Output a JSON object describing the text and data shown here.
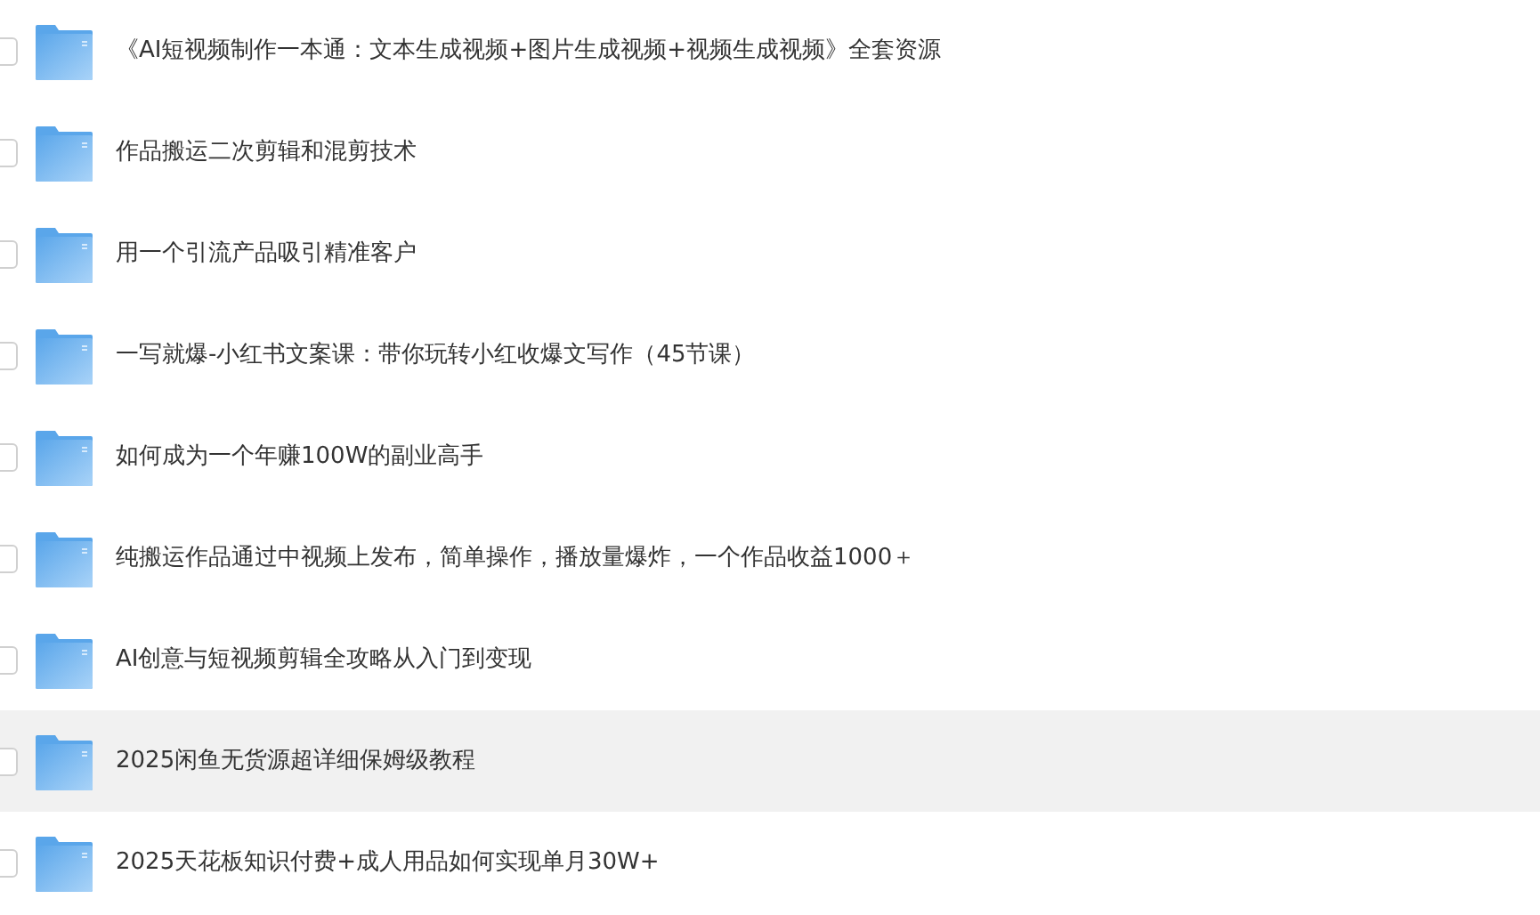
{
  "files": [
    {
      "name": "《AI短视频制作一本通：文本生成视频+图片生成视频+视频生成视频》全套资源",
      "checked": false,
      "highlighted": false
    },
    {
      "name": "作品搬运二次剪辑和混剪技术",
      "checked": false,
      "highlighted": false
    },
    {
      "name": "用一个引流产品吸引精准客户",
      "checked": false,
      "highlighted": false
    },
    {
      "name": "一写就爆-小红书文案课：带你玩转小红收爆文写作（45节课）",
      "checked": false,
      "highlighted": false
    },
    {
      "name": "如何成为一个年赚100W的副业高手",
      "checked": false,
      "highlighted": false
    },
    {
      "name": "纯搬运作品通过中视频上发布，简单操作，播放量爆炸，一个作品收益1000＋",
      "checked": false,
      "highlighted": false
    },
    {
      "name": "AI创意与短视频剪辑全攻略从入门到变现",
      "checked": false,
      "highlighted": false
    },
    {
      "name": "2025闲鱼无货源超详细保姆级教程",
      "checked": false,
      "highlighted": true
    },
    {
      "name": "2025天花板知识付费+成人用品如何实现单月30W+",
      "checked": false,
      "highlighted": false
    }
  ]
}
